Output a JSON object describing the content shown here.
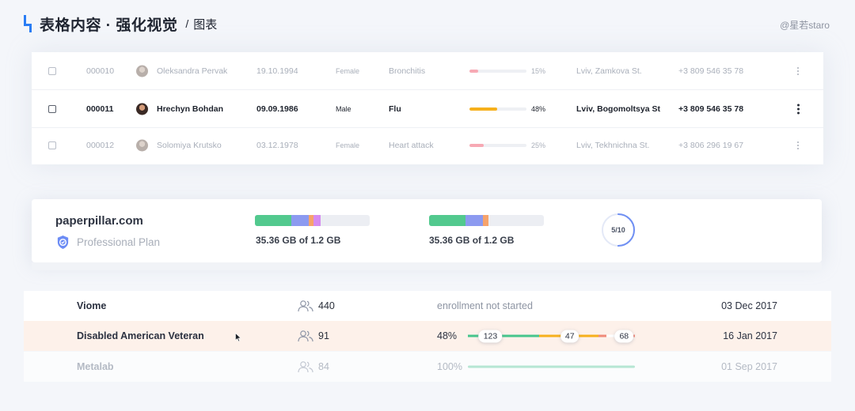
{
  "header": {
    "title": "表格内容 · 强化视觉",
    "separator": "/",
    "subtitle": "图表"
  },
  "watermark": "@星若staro",
  "patients": [
    {
      "id": "000010",
      "name": "Oleksandra Pervak",
      "dob": "19.10.1994",
      "sex": "Female",
      "diagnosis": "Bronchitis",
      "progress": 15,
      "progress_label": "15%",
      "bar_color": "#f7a9b4",
      "address": "Lviv, Zamkova St.",
      "phone": "+3 809 546 35 78",
      "state": "faded"
    },
    {
      "id": "000011",
      "name": "Hrechyn Bohdan",
      "dob": "09.09.1986",
      "sex": "Male",
      "diagnosis": "Flu",
      "progress": 48,
      "progress_label": "48%",
      "bar_color": "#f6b01c",
      "address": "Lviv, Bogomoltsya St",
      "phone": "+3 809 546 35 78",
      "state": "active"
    },
    {
      "id": "000012",
      "name": "Solomiya Krutsko",
      "dob": "03.12.1978",
      "sex": "Female",
      "diagnosis": "Heart attack",
      "progress": 25,
      "progress_label": "25%",
      "bar_color": "#f7a9b4",
      "address": "Lviv, Tekhnichna St.",
      "phone": "+3 806 296 19 67",
      "state": "faded"
    }
  ],
  "storage": {
    "site": "paperpillar.com",
    "plan": "Professional Plan",
    "bars": [
      {
        "label": "35.36 GB of 1.2 GB",
        "segments": [
          {
            "fraction": 0.32,
            "color": "#52c98e"
          },
          {
            "fraction": 0.15,
            "color": "#8c9af0"
          },
          {
            "fraction": 0.04,
            "color": "#f6a36b"
          },
          {
            "fraction": 0.06,
            "color": "#d58bf0"
          }
        ]
      },
      {
        "label": "35.36 GB of 1.2 GB",
        "segments": [
          {
            "fraction": 0.32,
            "color": "#52c98e"
          },
          {
            "fraction": 0.15,
            "color": "#8c9af0"
          },
          {
            "fraction": 0.05,
            "color": "#f6a36b"
          }
        ]
      }
    ],
    "ring": {
      "label": "5/10",
      "fraction": 0.5,
      "color": "#6f8ff3"
    }
  },
  "enrollments": [
    {
      "name": "Viome",
      "users": "440",
      "status": "enrollment not started",
      "date": "03 Dec 2017"
    },
    {
      "name": "Disabled American Veteran",
      "users": "91",
      "percent": "48%",
      "segments": [
        {
          "fraction": 0.27,
          "color": "#45c58c",
          "pill": "123"
        },
        {
          "fraction": 0.18,
          "color": "#45c58c"
        },
        {
          "fraction": 0.09,
          "color": "#f6b01c"
        },
        {
          "fraction": 0.14,
          "color": "#f6b01c",
          "pill": "47"
        },
        {
          "fraction": 0.14,
          "color": "#f6b01c"
        },
        {
          "fraction": 0.05,
          "color": "#f08a7a"
        },
        {
          "fraction": 0.13,
          "color": "#ffffff",
          "pill": "68"
        },
        {
          "fraction": 0.05,
          "color": "#f08a7a"
        }
      ],
      "date": "16 Jan 2017"
    },
    {
      "name": "Metalab",
      "users": "84",
      "percent": "100%",
      "date": "01 Sep 2017"
    }
  ]
}
